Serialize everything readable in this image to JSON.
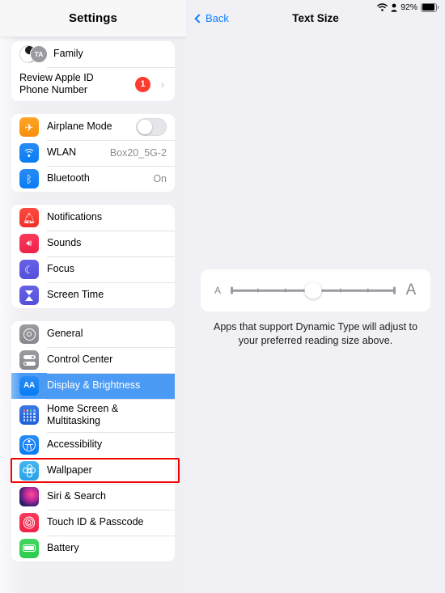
{
  "status_bar": {
    "wifi_icon": "wifi-icon",
    "person_icon": "person-icon",
    "battery_percent": "92%",
    "battery_icon": "battery-icon",
    "battery_level": 92
  },
  "sidebar": {
    "title": "Settings",
    "groups": [
      {
        "id": "account",
        "rows": [
          {
            "id": "family",
            "label": "Family",
            "icon": "family-avatars-icon",
            "avatar_initials": "TA"
          },
          {
            "id": "review-apple-id",
            "label": "Review Apple ID\nPhone Number",
            "badge": "1",
            "chevron": "chevron-right-icon"
          }
        ]
      },
      {
        "id": "connectivity",
        "rows": [
          {
            "id": "airplane-mode",
            "label": "Airplane Mode",
            "icon": "airplane-icon",
            "toggle": "off"
          },
          {
            "id": "wlan",
            "label": "WLAN",
            "icon": "wifi-icon",
            "value": "Box20_5G-2"
          },
          {
            "id": "bluetooth",
            "label": "Bluetooth",
            "icon": "bluetooth-icon",
            "value": "On"
          }
        ]
      },
      {
        "id": "alerts",
        "rows": [
          {
            "id": "notifications",
            "label": "Notifications",
            "icon": "bell-icon"
          },
          {
            "id": "sounds",
            "label": "Sounds",
            "icon": "speaker-icon"
          },
          {
            "id": "focus",
            "label": "Focus",
            "icon": "moon-icon"
          },
          {
            "id": "screen-time",
            "label": "Screen Time",
            "icon": "hourglass-icon"
          }
        ]
      },
      {
        "id": "system",
        "rows": [
          {
            "id": "general",
            "label": "General",
            "icon": "gear-icon"
          },
          {
            "id": "control-center",
            "label": "Control Center",
            "icon": "sliders-icon"
          },
          {
            "id": "display-brightness",
            "label": "Display & Brightness",
            "icon": "aa-icon",
            "selected": true
          },
          {
            "id": "home-screen",
            "label": "Home Screen &\nMultitasking",
            "icon": "app-grid-icon"
          },
          {
            "id": "accessibility",
            "label": "Accessibility",
            "icon": "accessibility-person-icon",
            "annotated": true
          },
          {
            "id": "wallpaper",
            "label": "Wallpaper",
            "icon": "flower-icon"
          },
          {
            "id": "siri-search",
            "label": "Siri & Search",
            "icon": "siri-orb-icon"
          },
          {
            "id": "touch-id-passcode",
            "label": "Touch ID & Passcode",
            "icon": "fingerprint-icon"
          },
          {
            "id": "battery",
            "label": "Battery",
            "icon": "battery-icon"
          }
        ]
      }
    ]
  },
  "detail": {
    "back_label": "Back",
    "back_icon": "chevron-left-icon",
    "title": "Text Size",
    "slider": {
      "small_a": "A",
      "large_a": "A",
      "steps": 7,
      "value": 4
    },
    "caption": "Apps that support Dynamic Type will adjust to your preferred reading size above."
  },
  "annotation": {
    "color": "#f00202",
    "target": "accessibility"
  }
}
